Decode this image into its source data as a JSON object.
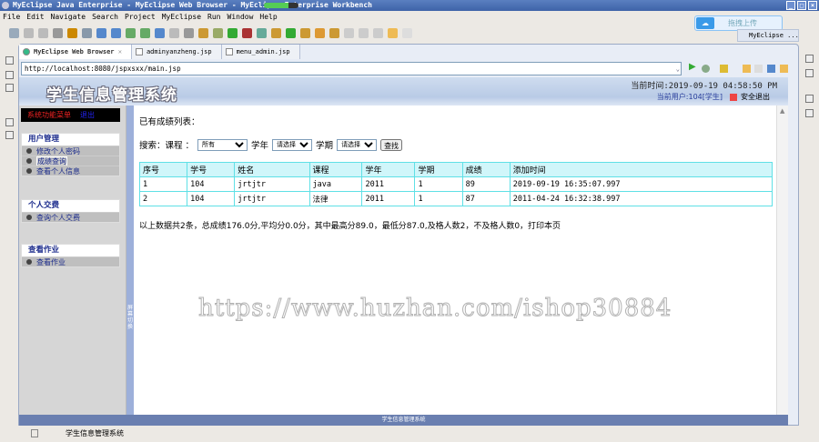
{
  "window": {
    "title": "MyEclipse Java Enterprise - MyEclipse Web Browser - MyEclipse Enterprise Workbench",
    "progress": 0.7
  },
  "menubar": [
    "File",
    "Edit",
    "Navigate",
    "Search",
    "Project",
    "MyEclipse",
    "Run",
    "Window",
    "Help"
  ],
  "upload_label": "拖拽上传",
  "perspective": "MyEclipse ...",
  "tabs": [
    {
      "label": "MyEclipse Web Browser"
    },
    {
      "label": "adminyanzheng.jsp"
    },
    {
      "label": "menu_admin.jsp"
    }
  ],
  "url": "http://localhost:8080/jspxsxx/main.jsp",
  "page": {
    "title": "学生信息管理系统",
    "time": "当前时间:2019-09-19 04:58:50 PM",
    "user": "当前用户:104[学生]",
    "logout": "安全退出",
    "menu_head": "系统功能菜单",
    "menu_exit": "退出",
    "groups": [
      {
        "title": "用户管理",
        "items": [
          "修改个人密码",
          "成绩查询",
          "查看个人信息"
        ]
      },
      {
        "title": "个人交费",
        "items": [
          "查询个人交费"
        ]
      },
      {
        "title": "查看作业",
        "items": [
          "查看作业"
        ]
      }
    ],
    "splitter_label": "屏幕切换",
    "list_title": "已有成绩列表：",
    "search": {
      "label": "搜索：课程 ：",
      "course": "所有",
      "year_label": "学年",
      "year": "请选择",
      "term_label": "学期",
      "term": "请选择",
      "button": "查找"
    },
    "table": {
      "headers": [
        "序号",
        "学号",
        "姓名",
        "课程",
        "学年",
        "学期",
        "成绩",
        "添加时间"
      ],
      "rows": [
        [
          "1",
          "104",
          "jrtjtr",
          "java",
          "2011",
          "1",
          "89",
          "2019-09-19 16:35:07.997"
        ],
        [
          "2",
          "104",
          "jrtjtr",
          "法律",
          "2011",
          "1",
          "87",
          "2011-04-24 16:32:38.997"
        ]
      ]
    },
    "summary": "以上数据共2条，总成绩176.0分,平均分0.0分，其中最高分89.0，最低分87.0,及格人数2，不及格人数0，打印本页",
    "footer": "学生信息管理系统"
  },
  "watermark": "https://www.huzhan.com/ishop30884",
  "status": "学生信息管理系统"
}
